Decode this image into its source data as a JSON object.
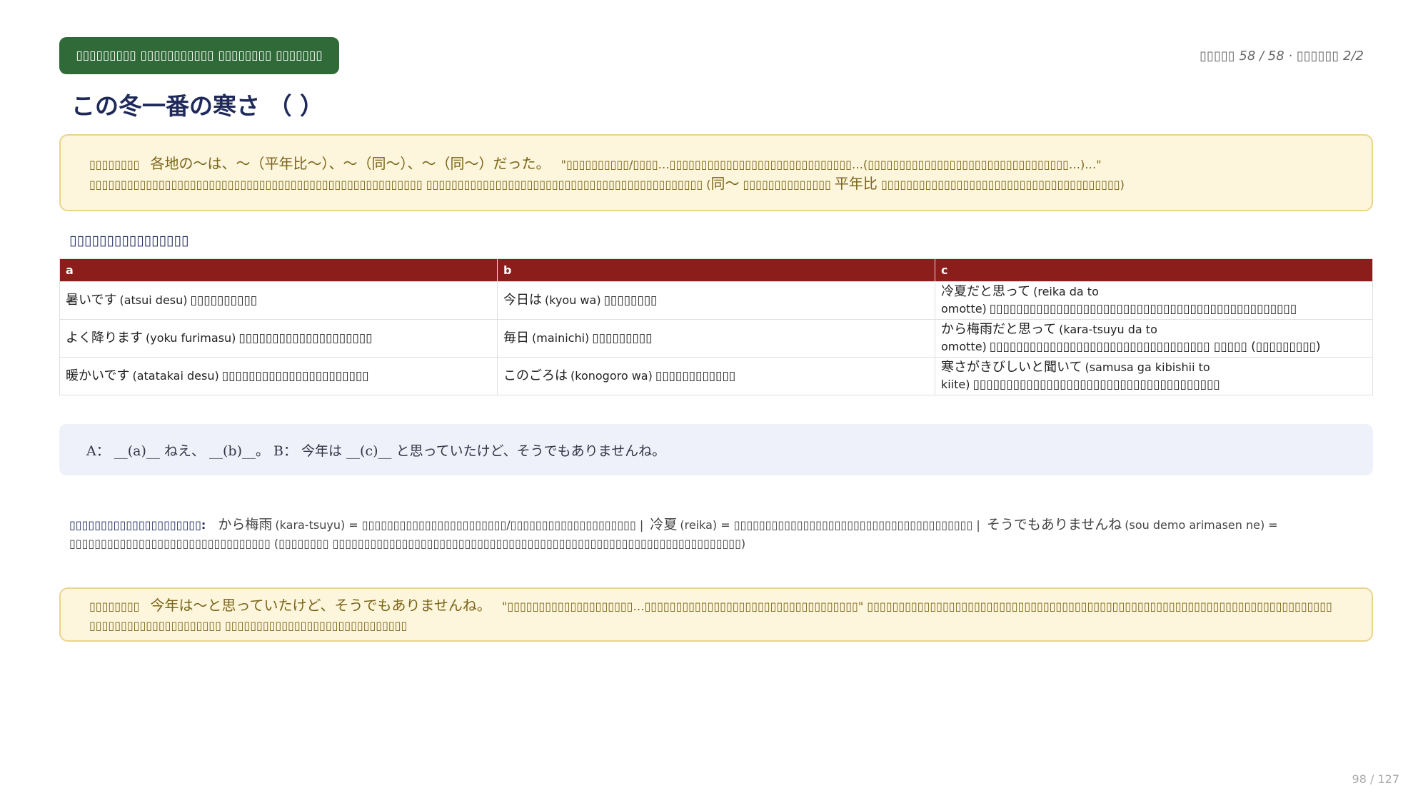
{
  "header": {
    "badge": "▯▯▯▯▯▯▯▯▯ ▯▯▯▯▯▯▯▯▯▯▯ ▯▯▯▯▯▯▯▯ ▯▯▯▯▯▯▯",
    "meta": "▯▯▯▯▯ 58 / 58 · ▯▯▯▯▯▯ 2/2"
  },
  "title": "この冬一番の寒さ （ ）",
  "note1": {
    "label": "▯▯▯▯▯▯▯▯",
    "pattern": "各地の～は、～（平年比～）、～（同～）、～（同～）だった。",
    "text_a": "\"▯▯▯▯▯▯▯▯▯▯/▯▯▯▯…▯▯▯▯▯▯▯▯▯▯▯▯▯▯▯▯▯▯▯▯▯▯▯▯▯▯▯▯▯…(▯▯▯▯▯▯▯▯▯▯▯▯▯▯▯▯▯▯▯▯▯▯▯▯▯▯▯▯▯▯▯▯…)…\" ▯▯▯▯▯▯▯▯▯▯▯▯▯▯▯▯▯▯▯▯▯▯▯▯▯▯▯▯▯▯▯▯▯▯▯▯▯▯▯▯▯▯▯▯▯▯▯▯▯▯▯▯▯ ▯▯▯▯▯▯▯▯▯▯▯▯▯▯▯▯▯▯▯▯▯▯▯▯▯▯▯▯▯▯▯▯▯▯▯▯▯▯▯▯▯▯▯▯ (",
    "strong_1": "同～",
    "text_b": " ▯▯▯▯▯▯▯▯▯▯▯▯▯▯ ",
    "strong_2": "平年比",
    "text_c": " ▯▯▯▯▯▯▯▯▯▯▯▯▯▯▯▯▯▯▯▯▯▯▯▯▯▯▯▯▯▯▯▯▯▯▯▯▯▯)"
  },
  "choices": {
    "heading": "▯▯▯▯▯▯▯▯▯▯▯▯▯▯▯▯",
    "columns": [
      "a",
      "b",
      "c"
    ],
    "rows": [
      [
        {
          "jp": "暑いです",
          "romaji": "(atsui desu)",
          "gloss": "▯▯▯▯▯▯▯▯▯▯"
        },
        {
          "jp": "今日は",
          "romaji": "(kyou wa)",
          "gloss": "▯▯▯▯▯▯▯▯"
        },
        {
          "jp": "冷夏だと思って",
          "romaji": "(reika da to omotte)",
          "gloss": "▯▯▯▯▯▯▯▯▯▯▯▯▯▯▯▯▯▯▯▯▯▯▯▯▯▯▯▯▯▯▯▯▯▯▯▯▯▯▯▯▯▯▯▯▯▯"
        }
      ],
      [
        {
          "jp": "よく降ります",
          "romaji": "(yoku furimasu)",
          "gloss": "▯▯▯▯▯▯▯▯▯▯▯▯▯▯▯▯▯▯▯▯"
        },
        {
          "jp": "毎日",
          "romaji": "(mainichi)",
          "gloss": "▯▯▯▯▯▯▯▯▯"
        },
        {
          "jp": "から梅雨だと思って",
          "romaji": "(kara-tsuyu da to omotte)",
          "gloss": "▯▯▯▯▯▯▯▯▯▯▯▯▯▯▯▯▯▯▯▯▯▯▯▯▯▯▯▯▯▯▯▯▯ ▯▯▯▯▯ (▯▯▯▯▯▯▯▯▯)"
        }
      ],
      [
        {
          "jp": "暖かいです",
          "romaji": "(atatakai desu)",
          "gloss": "▯▯▯▯▯▯▯▯▯▯▯▯▯▯▯▯▯▯▯▯▯▯"
        },
        {
          "jp": "このごろは",
          "romaji": "(konogoro wa)",
          "gloss": "▯▯▯▯▯▯▯▯▯▯▯▯"
        },
        {
          "jp": "寒さがきびしいと聞いて",
          "romaji": "(samusa ga kibishii to kiite)",
          "gloss": "▯▯▯▯▯▯▯▯▯▯▯▯▯▯▯▯▯▯▯▯▯▯▯▯▯▯▯▯▯▯▯▯▯▯▯▯▯"
        }
      ]
    ]
  },
  "dialog": "A： __(a)__ ねえ、 __(b)__。 B： 今年は __(c)__ と思っていたけど、そうでもありませんね。",
  "vocab": {
    "label": "▯▯▯▯▯▯▯▯▯▯▯▯▯▯▯▯▯▯▯▯▯:",
    "entries": [
      {
        "jp": "から梅雨",
        "rest": "(kara-tsuyu) = ▯▯▯▯▯▯▯▯▯▯▯▯▯▯▯▯▯▯▯▯▯▯▯/▯▯▯▯▯▯▯▯▯▯▯▯▯▯▯▯▯▯▯▯ | "
      },
      {
        "jp": "冷夏",
        "rest": "(reika) = ▯▯▯▯▯▯▯▯▯▯▯▯▯▯▯▯▯▯▯▯▯▯▯▯▯▯▯▯▯▯▯▯▯▯▯▯▯▯ | "
      },
      {
        "jp": "そうでもありませんね",
        "rest": "(sou demo arimasen ne) = ▯▯▯▯▯▯▯▯▯▯▯▯▯▯▯▯▯▯▯▯▯▯▯▯▯▯▯▯▯▯▯▯ (▯▯▯▯▯▯▯▯ ▯▯▯▯▯▯▯▯▯▯▯▯▯▯▯▯▯▯▯▯▯▯▯▯▯▯▯▯▯▯▯▯▯▯▯▯▯▯▯▯▯▯▯▯▯▯▯▯▯▯▯▯▯▯▯▯▯▯▯▯▯▯▯▯▯)"
      }
    ]
  },
  "note2": {
    "label": "▯▯▯▯▯▯▯▯",
    "pattern": "今年は～と思っていたけど、そうでもありませんね。",
    "text": "\"▯▯▯▯▯▯▯▯▯▯▯▯▯▯▯▯▯▯▯▯…▯▯▯▯▯▯▯▯▯▯▯▯▯▯▯▯▯▯▯▯▯▯▯▯▯▯▯▯▯▯▯▯▯▯\" ▯▯▯▯▯▯▯▯▯▯▯▯▯▯▯▯▯▯▯▯▯▯▯▯▯▯▯▯▯▯▯▯▯▯▯▯▯▯▯▯▯▯▯▯▯▯▯▯▯▯▯▯▯▯▯▯▯▯▯▯▯▯▯▯▯▯▯▯▯▯▯▯▯▯ ▯▯▯▯▯▯▯▯▯▯▯▯▯▯▯▯▯▯▯▯▯ ▯▯▯▯▯▯▯▯▯▯▯▯▯▯▯▯▯▯▯▯▯▯▯▯▯▯▯▯▯"
  },
  "footer": {
    "counter": "98 / 127"
  }
}
